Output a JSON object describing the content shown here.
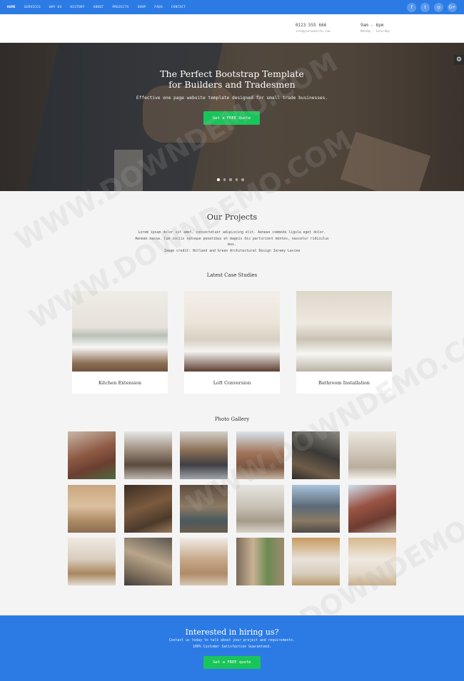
{
  "nav": {
    "items": [
      "HOME",
      "SERVICES",
      "WHY US",
      "HISTORY",
      "ABOUT",
      "PROJECTS",
      "SHOP",
      "FAQS",
      "CONTACT"
    ],
    "social": [
      "f",
      "t",
      "◎",
      "G+"
    ]
  },
  "info": {
    "phone": "0123 555 666",
    "email": "info@yourwebsite.com",
    "hours": "9am - 6pm",
    "days": "Monday - Saturday"
  },
  "hero": {
    "title_line1": "The Perfect Bootstrap Template",
    "title_line2": "for Builders and Tradesmen",
    "subtitle": "Effective one page website template designed for small trade businesses.",
    "button": "Get a FREE Quote",
    "slides": 5,
    "active_slide": 1
  },
  "projects": {
    "title": "Our Projects",
    "text_line1": "Lorem ipsum dolor sit amet, consectetuer adipiscing elit. Aenean commodo ligula eget dolor.",
    "text_line2": "Aenean massa. Cum sociis natoque penatibus et magnis dis parturient montes, nascetur ridiculus",
    "text_line3": "mus.",
    "credit": "Image credit: Holland and Green Architectural Design Jeremy Levine",
    "cases_title": "Latest Case Studies",
    "cases": [
      "Kitchen Extension",
      "Loft Conversion",
      "Bathroom Installation"
    ],
    "gallery_title": "Photo Gallery"
  },
  "cta": {
    "title": "Interested in hiring us?",
    "line1": "Contact us today to talk about your project and requirements.",
    "line2": "100% Customer Satisfaction Guaranteed.",
    "button": "Get a FREE quote"
  },
  "watermark": "WWW.DOWNDEMO.COM",
  "colors": {
    "primary": "#2c7be5",
    "accent": "#19c55a"
  }
}
